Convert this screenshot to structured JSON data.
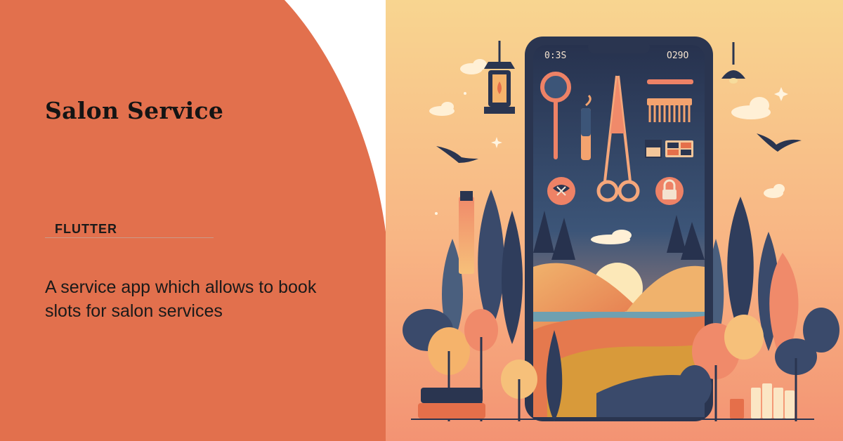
{
  "panel": {
    "title": "Salon Service",
    "tag": "FLUTTER",
    "description": "A service app which allows to book slots for salon services"
  },
  "phone": {
    "status_left": "0:3S",
    "status_right": "O29O"
  },
  "colors": {
    "panel_background": "#e2704d",
    "illustration_background_top": "#f8d590",
    "illustration_background_bottom": "#f39373",
    "phone_frame": "#2a3550"
  },
  "icons": [
    "lantern-icon",
    "magnifier-icon",
    "scissors-icon",
    "comb-icon",
    "lock-icon",
    "bird-icon",
    "cloud-icon",
    "tree-icon"
  ]
}
